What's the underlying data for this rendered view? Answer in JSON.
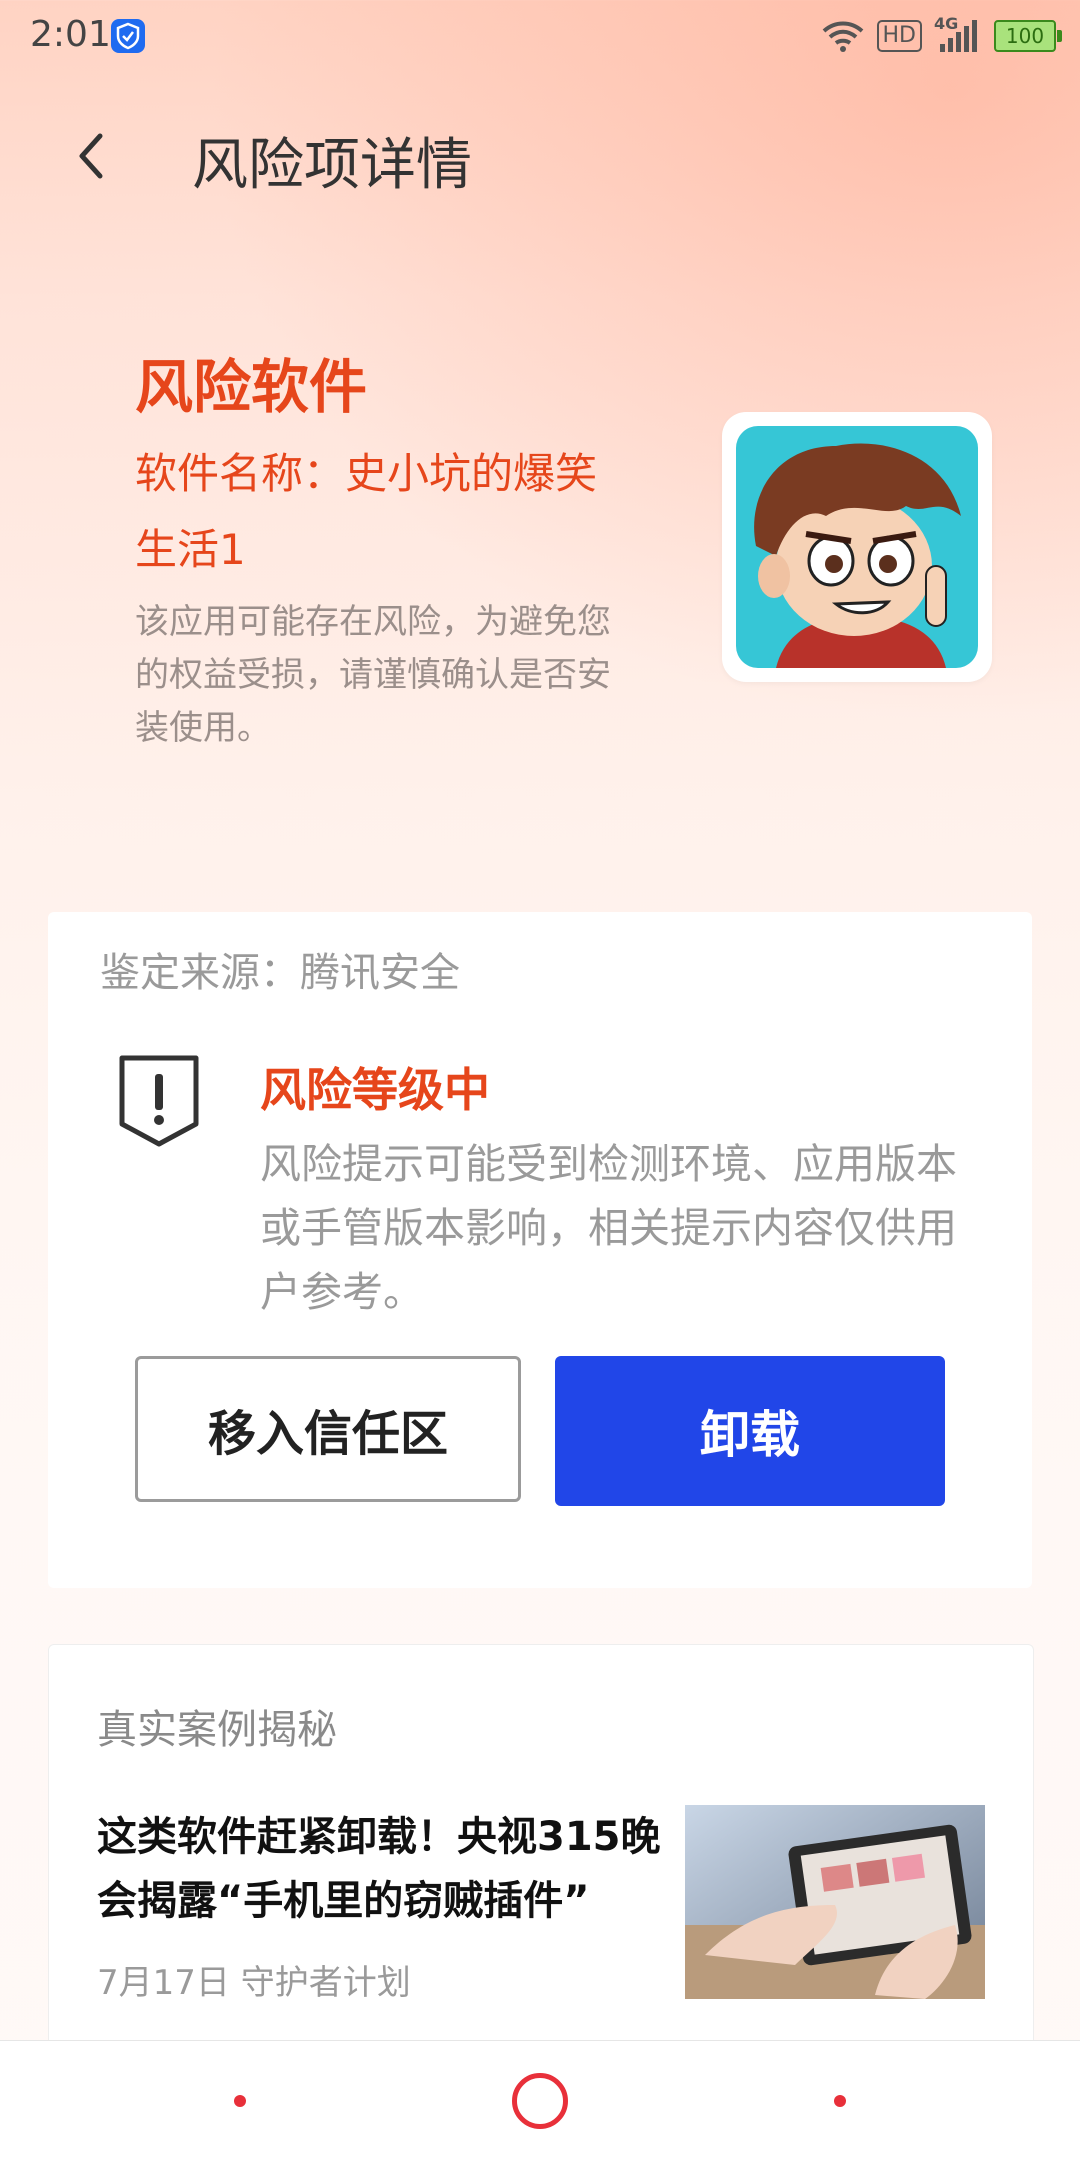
{
  "status_bar": {
    "time": "2:01",
    "network_label": "HD",
    "cellular_label": "4G",
    "battery": "100"
  },
  "header": {
    "title": "风险项详情"
  },
  "risk": {
    "title": "风险软件",
    "app_name": "软件名称：史小坑的爆笑生活1",
    "description": "该应用可能存在风险，为避免您的权益受损，请谨慎确认是否安装使用。"
  },
  "assessment": {
    "source": "鉴定来源：腾讯安全",
    "level_title": "风险等级中",
    "level_description": "风险提示可能受到检测环境、应用版本或手管版本影响，相关提示内容仅供用户参考。",
    "trust_button": "移入信任区",
    "uninstall_button": "卸载"
  },
  "cases": {
    "title": "真实案例揭秘",
    "article": {
      "title": "这类软件赶紧卸载！央视315晚会揭露“手机里的窃贼插件”",
      "meta": "7月17日 守护者计划"
    }
  },
  "colors": {
    "accent_red": "#e6461b",
    "primary_blue": "#2146e8",
    "nav_red": "#e8303a"
  },
  "icons": [
    "shield-check-icon",
    "wifi-icon",
    "signal-icon",
    "battery-icon",
    "back-arrow-icon",
    "warning-shield-icon",
    "home-circle-icon"
  ]
}
